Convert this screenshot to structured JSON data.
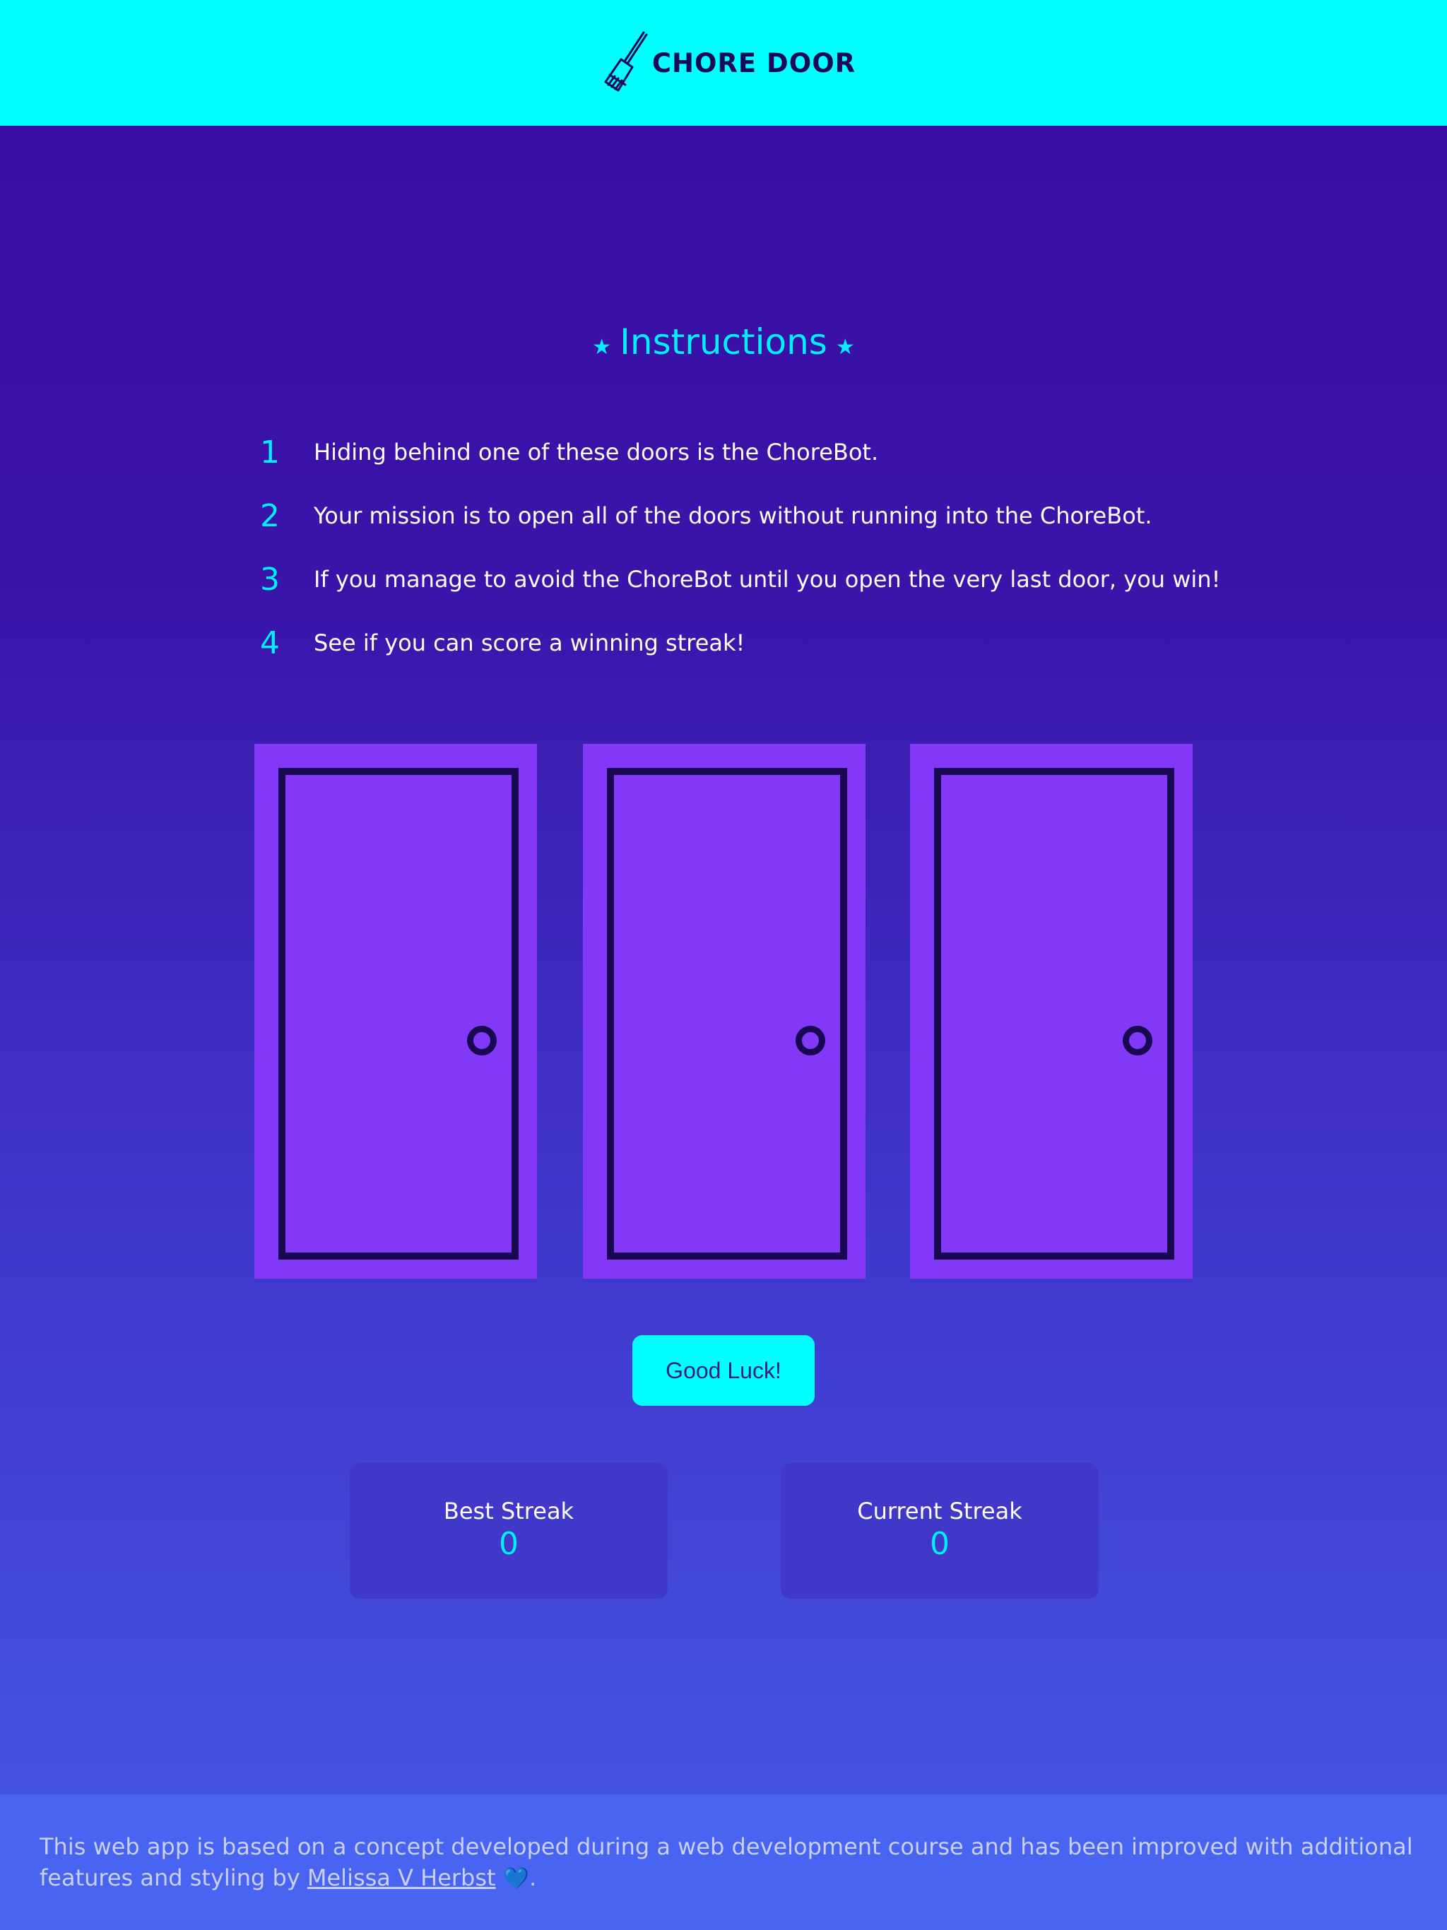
{
  "header": {
    "logo_icon": "broom-icon",
    "title": "CHORE DOOR"
  },
  "instructions": {
    "star_icon": "star-icon",
    "title": "Instructions",
    "steps": [
      {
        "num": "1",
        "text": "Hiding behind one of these doors is the ChoreBot."
      },
      {
        "num": "2",
        "text": "Your mission is to open all of the doors without running into the ChoreBot."
      },
      {
        "num": "3",
        "text": "If you manage to avoid the ChoreBot until you open the very last door, you win!"
      },
      {
        "num": "4",
        "text": "See if you can score a winning streak!"
      }
    ]
  },
  "doors": {
    "count": 3,
    "door_color": "#8338f7",
    "outline_color": "#17084f"
  },
  "button": {
    "label": "Good Luck!"
  },
  "streaks": {
    "best": {
      "label": "Best Streak",
      "value": "0"
    },
    "current": {
      "label": "Current Streak",
      "value": "0"
    }
  },
  "footer": {
    "text_before": "This web app is based on a concept developed during a web development course and has been improved with additional features and styling by ",
    "author_link": "Melissa V Herbst",
    "heart": "💙",
    "text_after": "."
  },
  "colors": {
    "accent": "#00ffff",
    "background_top": "#3a0ca3",
    "background_bottom": "#4459e6"
  }
}
